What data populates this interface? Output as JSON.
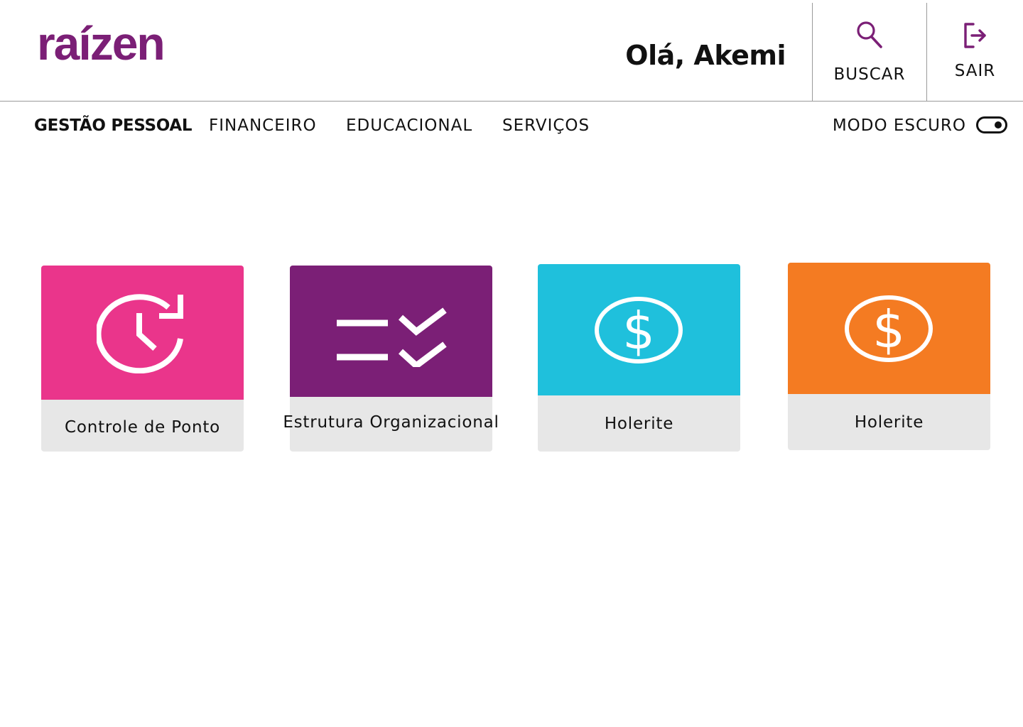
{
  "app": {
    "logo_text": "raízen",
    "brand_color": "#7b1f76"
  },
  "header": {
    "greeting": "Olá, Akemi",
    "search_label": "BUSCAR",
    "search_icon": "search-icon",
    "logout_label": "SAIR",
    "logout_icon": "logout-icon"
  },
  "nav": {
    "items": [
      {
        "label": "GESTÃO PESSOAL",
        "active": true
      },
      {
        "label": "FINANCEIRO",
        "active": false
      },
      {
        "label": "EDUCACIONAL",
        "active": false
      },
      {
        "label": "SERVIÇOS",
        "active": false
      }
    ],
    "dark_mode_label": "MODO ESCURO",
    "dark_mode_on": true
  },
  "cards": [
    {
      "title": "Controle de Ponto",
      "icon": "clock-refresh-icon",
      "color": "#ea358b"
    },
    {
      "title": "Estrutura Organizacional",
      "icon": "checklist-icon",
      "color": "#7b1f76"
    },
    {
      "title": "Holerite",
      "icon": "dollar-coin-icon",
      "color": "#1fc0dc"
    },
    {
      "title": "Holerite",
      "icon": "dollar-coin-icon",
      "color": "#f47b22"
    }
  ]
}
